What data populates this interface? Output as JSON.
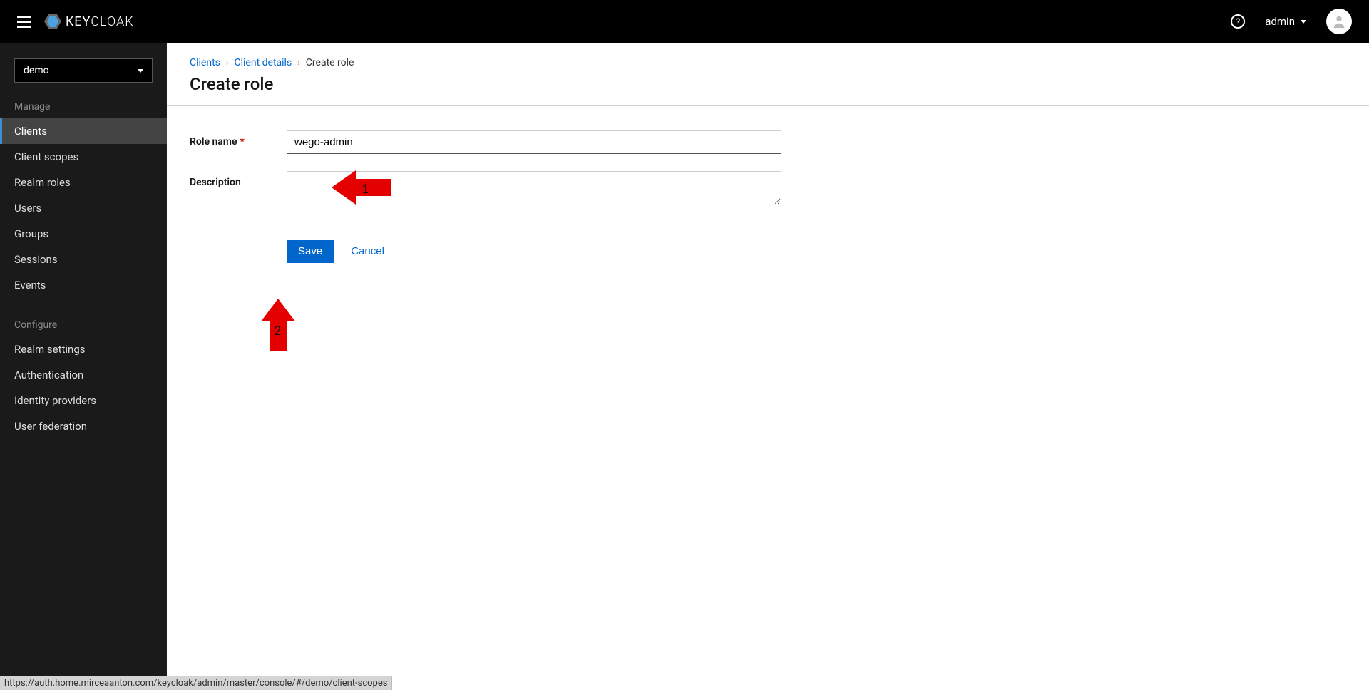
{
  "header": {
    "logo_text": "KEYCLOAK",
    "user_label": "admin"
  },
  "realm": {
    "selected": "demo"
  },
  "sidebar": {
    "manage_title": "Manage",
    "configure_title": "Configure",
    "manage_items": [
      {
        "label": "Clients",
        "active": true
      },
      {
        "label": "Client scopes"
      },
      {
        "label": "Realm roles"
      },
      {
        "label": "Users"
      },
      {
        "label": "Groups"
      },
      {
        "label": "Sessions"
      },
      {
        "label": "Events"
      }
    ],
    "configure_items": [
      {
        "label": "Realm settings"
      },
      {
        "label": "Authentication"
      },
      {
        "label": "Identity providers"
      },
      {
        "label": "User federation"
      }
    ]
  },
  "breadcrumb": {
    "link1": "Clients",
    "link2": "Client details",
    "current": "Create role"
  },
  "page": {
    "title": "Create role"
  },
  "form": {
    "role_name_label": "Role name",
    "role_name_value": "wego-admin",
    "description_label": "Description",
    "description_value": "",
    "save_label": "Save",
    "cancel_label": "Cancel"
  },
  "annotations": {
    "label1": "1",
    "label2": "2"
  },
  "status": {
    "url": "https://auth.home.mirceaanton.com/keycloak/admin/master/console/#/demo/client-scopes"
  }
}
